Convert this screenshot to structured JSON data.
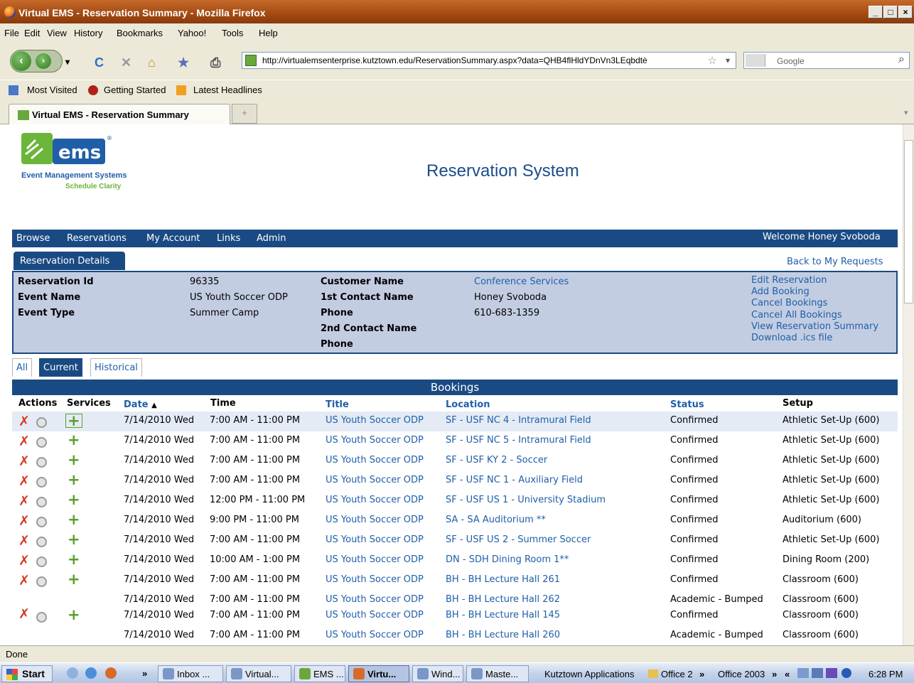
{
  "window": {
    "title": "Virtual EMS - Reservation Summary - Mozilla Firefox",
    "min": "_",
    "max": "□",
    "close": "×"
  },
  "menu": [
    "File",
    "Edit",
    "View",
    "History",
    "Bookmarks",
    "Yahoo!",
    "Tools",
    "Help"
  ],
  "nav": {
    "back": "‹",
    "forward": "›",
    "dropdown": "▾",
    "reload": "C",
    "stop": "✕",
    "home": "⌂",
    "bookmark_icon": "★",
    "print_icon": "⎙",
    "url": "http://virtualemsenterprise.kutztown.edu/ReservationSummary.aspx?data=QHB4flHldYDnVn3LEqbdtè",
    "url_star": "☆",
    "url_drop": "▾",
    "search_placeholder": "Google",
    "search_icon": "⌕"
  },
  "bookmarks": [
    "Most Visited",
    "Getting Started",
    "Latest Headlines"
  ],
  "tabs": {
    "active": "Virtual EMS - Reservation Summary",
    "new": "+",
    "overflow": "▾"
  },
  "logo": {
    "name": "ems",
    "tagline": "Event Management Systems",
    "subtag": "Schedule Clarity",
    "registered": "®"
  },
  "page": {
    "system_title": "Reservation System",
    "welcome": "Welcome Honey Svoboda",
    "nav": [
      "Browse",
      "Reservations",
      "My Account",
      "Links",
      "Admin"
    ],
    "details_tab": "Reservation Details",
    "back_link": "Back to My Requests"
  },
  "details": {
    "reservation_id_label": "Reservation Id",
    "reservation_id": "96335",
    "event_name_label": "Event Name",
    "event_name": "US Youth Soccer ODP",
    "event_type_label": "Event Type",
    "event_type": "Summer Camp",
    "customer_name_label": "Customer Name",
    "customer_name": "Conference Services",
    "contact1_label": "1st Contact Name",
    "contact1": "Honey Svoboda",
    "phone1_label": "Phone",
    "phone1": "610-683-1359",
    "contact2_label": "2nd Contact Name",
    "phone2_label": "Phone",
    "actions": [
      "Edit Reservation",
      "Add Booking",
      "Cancel Bookings",
      "Cancel All Bookings",
      "View Reservation Summary",
      "Download .ics file"
    ]
  },
  "subtabs": [
    "All",
    "Current",
    "Historical"
  ],
  "bookings": {
    "header": "Bookings",
    "columns": {
      "actions": "Actions",
      "services": "Services",
      "date": "Date",
      "sort": "▲",
      "time": "Time",
      "title": "Title",
      "location": "Location",
      "status": "Status",
      "setup": "Setup"
    },
    "icons": {
      "cancel": "✗",
      "add": "+"
    },
    "rows": [
      {
        "date": "7/14/2010 Wed",
        "time": "7:00 AM - 11:00 PM",
        "title": "US Youth Soccer ODP",
        "location": "SF - USF NC 4 - Intramural Field",
        "status": "Confirmed",
        "setup": "Athletic Set-Up (600)"
      },
      {
        "date": "7/14/2010 Wed",
        "time": "7:00 AM - 11:00 PM",
        "title": "US Youth Soccer ODP",
        "location": "SF - USF NC 5 - Intramural Field",
        "status": "Confirmed",
        "setup": "Athletic Set-Up (600)"
      },
      {
        "date": "7/14/2010 Wed",
        "time": "7:00 AM - 11:00 PM",
        "title": "US Youth Soccer ODP",
        "location": "SF - USF KY 2 - Soccer",
        "status": "Confirmed",
        "setup": "Athletic Set-Up (600)"
      },
      {
        "date": "7/14/2010 Wed",
        "time": "7:00 AM - 11:00 PM",
        "title": "US Youth Soccer ODP",
        "location": "SF - USF NC 1 - Auxiliary Field",
        "status": "Confirmed",
        "setup": "Athletic Set-Up (600)"
      },
      {
        "date": "7/14/2010 Wed",
        "time": "12:00 PM - 11:00 PM",
        "title": "US Youth Soccer ODP",
        "location": "SF - USF US 1 - University Stadium",
        "status": "Confirmed",
        "setup": "Athletic Set-Up (600)"
      },
      {
        "date": "7/14/2010 Wed",
        "time": "9:00 PM - 11:00 PM",
        "title": "US Youth Soccer ODP",
        "location": "SA - SA Auditorium **",
        "status": "Confirmed",
        "setup": "Auditorium (600)"
      },
      {
        "date": "7/14/2010 Wed",
        "time": "7:00 AM - 11:00 PM",
        "title": "US Youth Soccer ODP",
        "location": "SF - USF US 2 - Summer Soccer",
        "status": "Confirmed",
        "setup": "Athletic Set-Up (600)"
      },
      {
        "date": "7/14/2010 Wed",
        "time": "10:00 AM - 1:00 PM",
        "title": "US Youth Soccer ODP",
        "location": "DN - SDH Dining Room 1**",
        "status": "Confirmed",
        "setup": "Dining Room (200)"
      },
      {
        "date": "7/14/2010 Wed",
        "time": "7:00 AM - 11:00 PM",
        "title": "US Youth Soccer ODP",
        "location": "BH - BH Lecture Hall 261",
        "status": "Confirmed",
        "setup": "Classroom (600)"
      },
      {
        "date": "7/14/2010 Wed",
        "time": "7:00 AM - 11:00 PM",
        "title": "US Youth Soccer ODP",
        "location": "BH - BH Lecture Hall 262",
        "status": "Academic - Bumped",
        "setup": "Classroom (600)"
      },
      {
        "date": "7/14/2010 Wed",
        "time": "7:00 AM - 11:00 PM",
        "title": "US Youth Soccer ODP",
        "location": "BH - BH Lecture Hall 145",
        "status": "Confirmed",
        "setup": "Classroom (600)"
      },
      {
        "date": "7/14/2010 Wed",
        "time": "7:00 AM - 11:00 PM",
        "title": "US Youth Soccer ODP",
        "location": "BH - BH Lecture Hall 260",
        "status": "Academic - Bumped",
        "setup": "Classroom (600)"
      }
    ]
  },
  "status": "Done",
  "taskbar": {
    "start": "Start",
    "quick_more": "»",
    "items": [
      "Inbox ...",
      "Virtual...",
      "EMS ...",
      "Virtu...",
      "Wind...",
      "Maste..."
    ],
    "tray_items": [
      "Kutztown Applications",
      "Office 2",
      "»",
      "Office 2003",
      "»",
      "«"
    ],
    "clock": "6:28 PM"
  }
}
